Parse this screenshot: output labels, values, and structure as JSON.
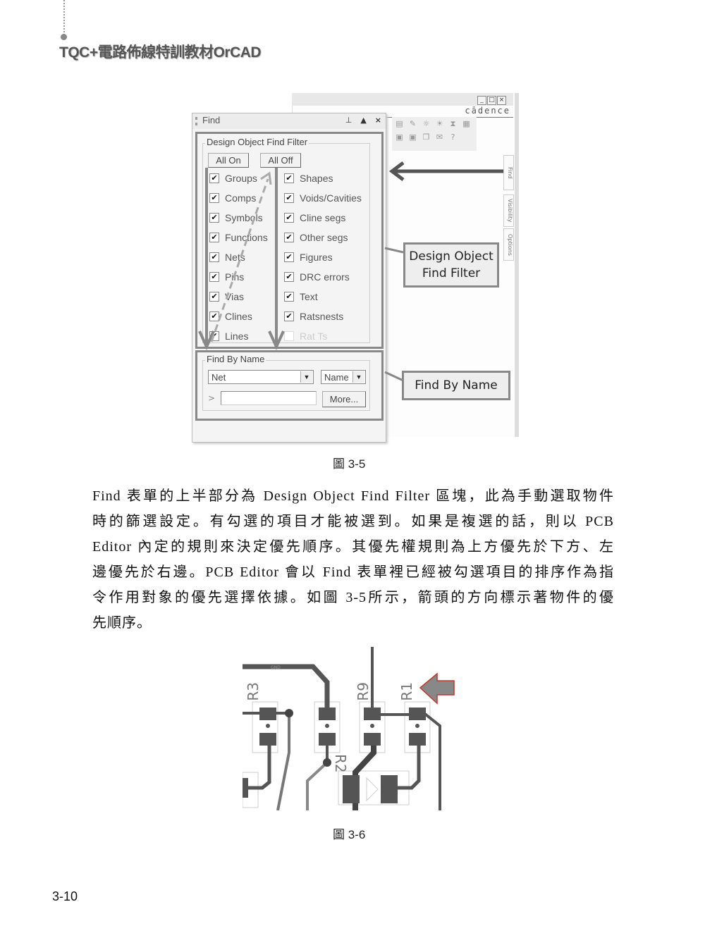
{
  "header": {
    "book_title": "TQC+電路佈線特訓教材OrCAD"
  },
  "figure_3_5": {
    "caption": "圖 3-5",
    "app": {
      "window_buttons": [
        "_",
        "□",
        "×"
      ],
      "brand": "cādence",
      "toolbar_icons": [
        "measure-icon",
        "pen-icon",
        "sun-icon",
        "bulb-icon",
        "hourglass-icon",
        "network-icon",
        "gift-icon",
        "gift-icon",
        "stack-icon",
        "envelope-icon",
        "help-icon"
      ],
      "side_tabs": [
        "Find",
        "Visibility",
        "Options"
      ]
    },
    "find_panel": {
      "title": "Find",
      "title_buttons": {
        "pin": "pin-icon",
        "collapse": "▲",
        "close": "×"
      },
      "filter_group": {
        "legend": "Design Object Find Filter",
        "all_on_label": "All On",
        "all_off_label": "All Off",
        "left_column": [
          {
            "label": "Groups",
            "checked": true
          },
          {
            "label": "Comps",
            "checked": true
          },
          {
            "label": "Symbols",
            "checked": true
          },
          {
            "label": "Functions",
            "checked": true
          },
          {
            "label": "Nets",
            "checked": true
          },
          {
            "label": "Pins",
            "checked": true
          },
          {
            "label": "Vias",
            "checked": true
          },
          {
            "label": "Clines",
            "checked": true
          },
          {
            "label": "Lines",
            "checked": true
          }
        ],
        "right_column": [
          {
            "label": "Shapes",
            "checked": true
          },
          {
            "label": "Voids/Cavities",
            "checked": true
          },
          {
            "label": "Cline segs",
            "checked": true
          },
          {
            "label": "Other segs",
            "checked": true
          },
          {
            "label": "Figures",
            "checked": true
          },
          {
            "label": "DRC errors",
            "checked": true
          },
          {
            "label": "Text",
            "checked": true
          },
          {
            "label": "Ratsnests",
            "checked": true
          },
          {
            "label": "Rat Ts",
            "checked": false,
            "disabled": true
          }
        ]
      },
      "name_group": {
        "legend": "Find By Name",
        "type_select_value": "Net",
        "mode_select_value": "Name",
        "prompt": ">",
        "name_input_value": "",
        "more_button_label": "More..."
      }
    },
    "callouts": {
      "filter": [
        "Design Object",
        "Find Filter"
      ],
      "name": "Find By Name"
    }
  },
  "body": {
    "paragraph_lines": [
      "Find 表單的上半部分為 Design Object Find Filter 區塊，此為手動選取物件",
      "時的篩選設定。有勾選的項目才能被選到。如果是複選的話，則以 PCB",
      "Editor 內定的規則來決定優先順序。其優先權規則為上方優先於下方、左",
      "邊優先於右邊。PCB Editor 會以 Find 表單裡已經被勾選項目的排序作為指",
      "令作用對象的優先選擇依據。如圖 3-5所示，箭頭的方向標示著物件的優",
      "先順序。"
    ]
  },
  "figure_3_6": {
    "caption": "圖 3-6",
    "refdes": [
      "R3",
      "R9",
      "R1",
      "R2"
    ],
    "net_label": "GND"
  },
  "footer": {
    "page_number": "3-10"
  }
}
